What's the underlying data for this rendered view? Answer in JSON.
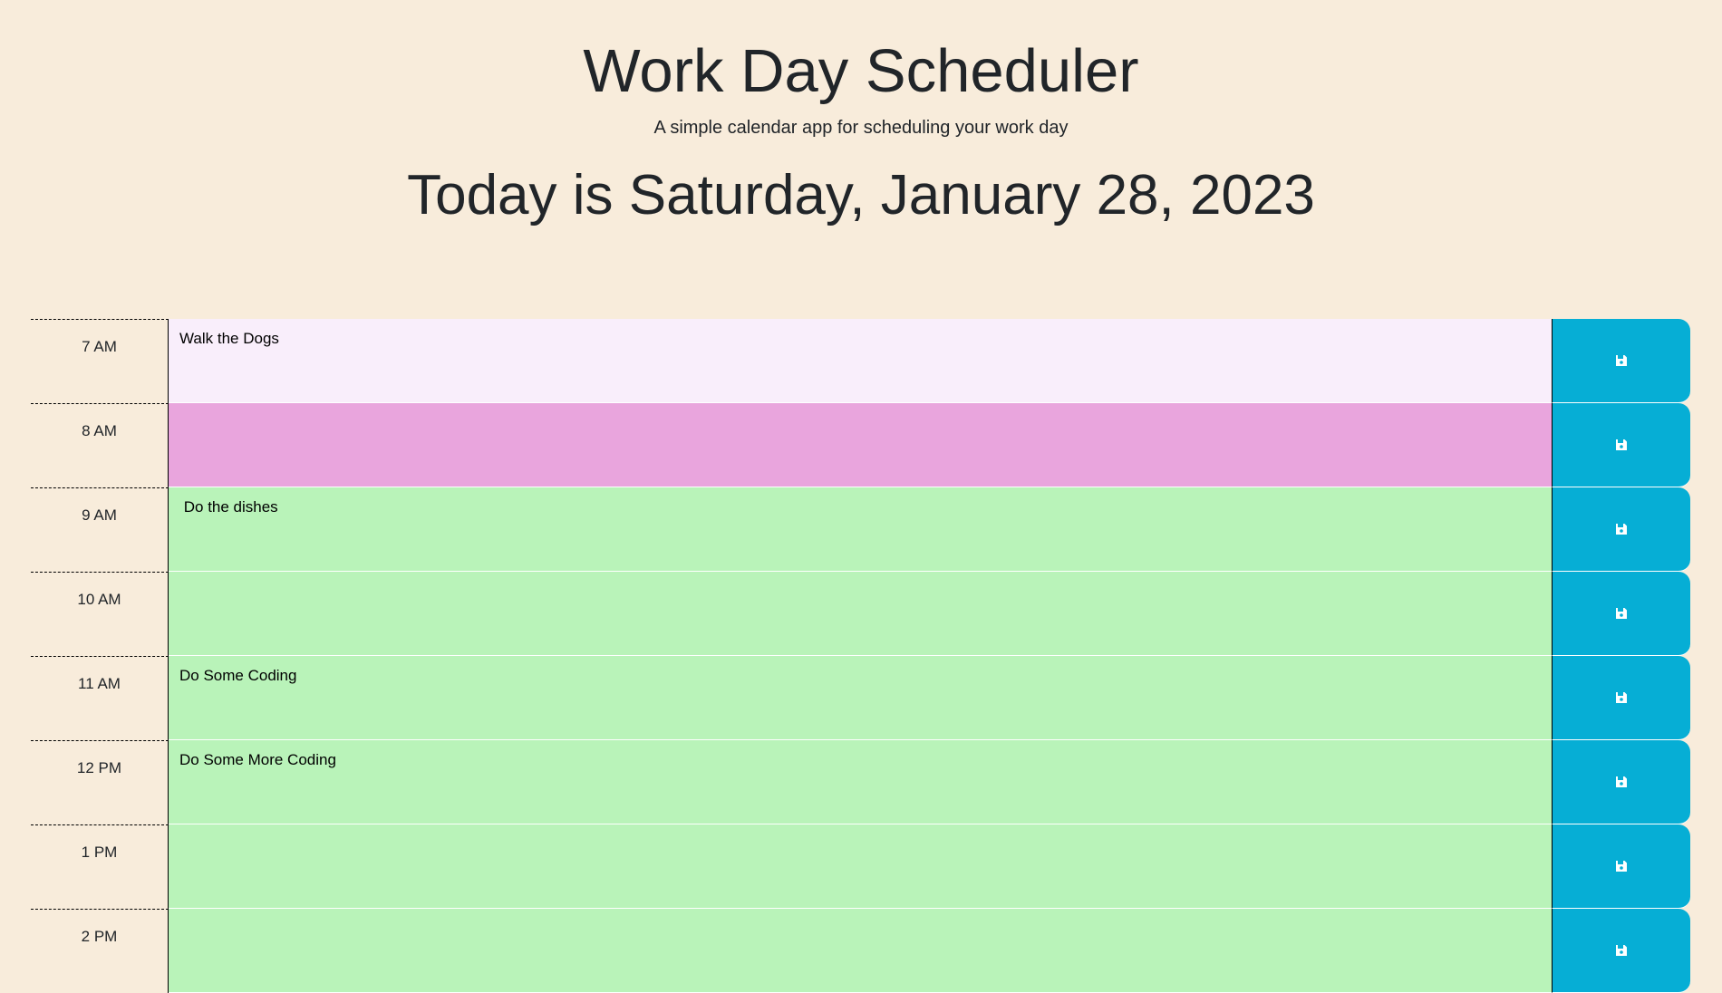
{
  "header": {
    "title": "Work Day Scheduler",
    "subtitle": "A simple calendar app for scheduling your work day",
    "today": "Today is Saturday, January 28, 2023"
  },
  "colors": {
    "background": "#f8ecdb",
    "past": "#f9eefb",
    "present": "#e9a5dd",
    "future": "#b9f3b9",
    "save_button": "#06aed5"
  },
  "rows": [
    {
      "hour": "7 AM",
      "text": "Walk the Dogs",
      "status": "past",
      "icon": "floppy-disk-icon"
    },
    {
      "hour": "8 AM",
      "text": "",
      "status": "present",
      "icon": "floppy-disk-icon"
    },
    {
      "hour": "9 AM",
      "text": " Do the dishes",
      "status": "future",
      "icon": "floppy-disk-icon"
    },
    {
      "hour": "10 AM",
      "text": "",
      "status": "future",
      "icon": "floppy-disk-icon"
    },
    {
      "hour": "11 AM",
      "text": "Do Some Coding",
      "status": "future",
      "icon": "floppy-disk-icon"
    },
    {
      "hour": "12 PM",
      "text": "Do Some More Coding",
      "status": "future",
      "icon": "floppy-disk-icon"
    },
    {
      "hour": "1 PM",
      "text": "",
      "status": "future",
      "icon": "floppy-disk-icon"
    },
    {
      "hour": "2 PM",
      "text": "",
      "status": "future",
      "icon": "floppy-disk-icon"
    }
  ]
}
